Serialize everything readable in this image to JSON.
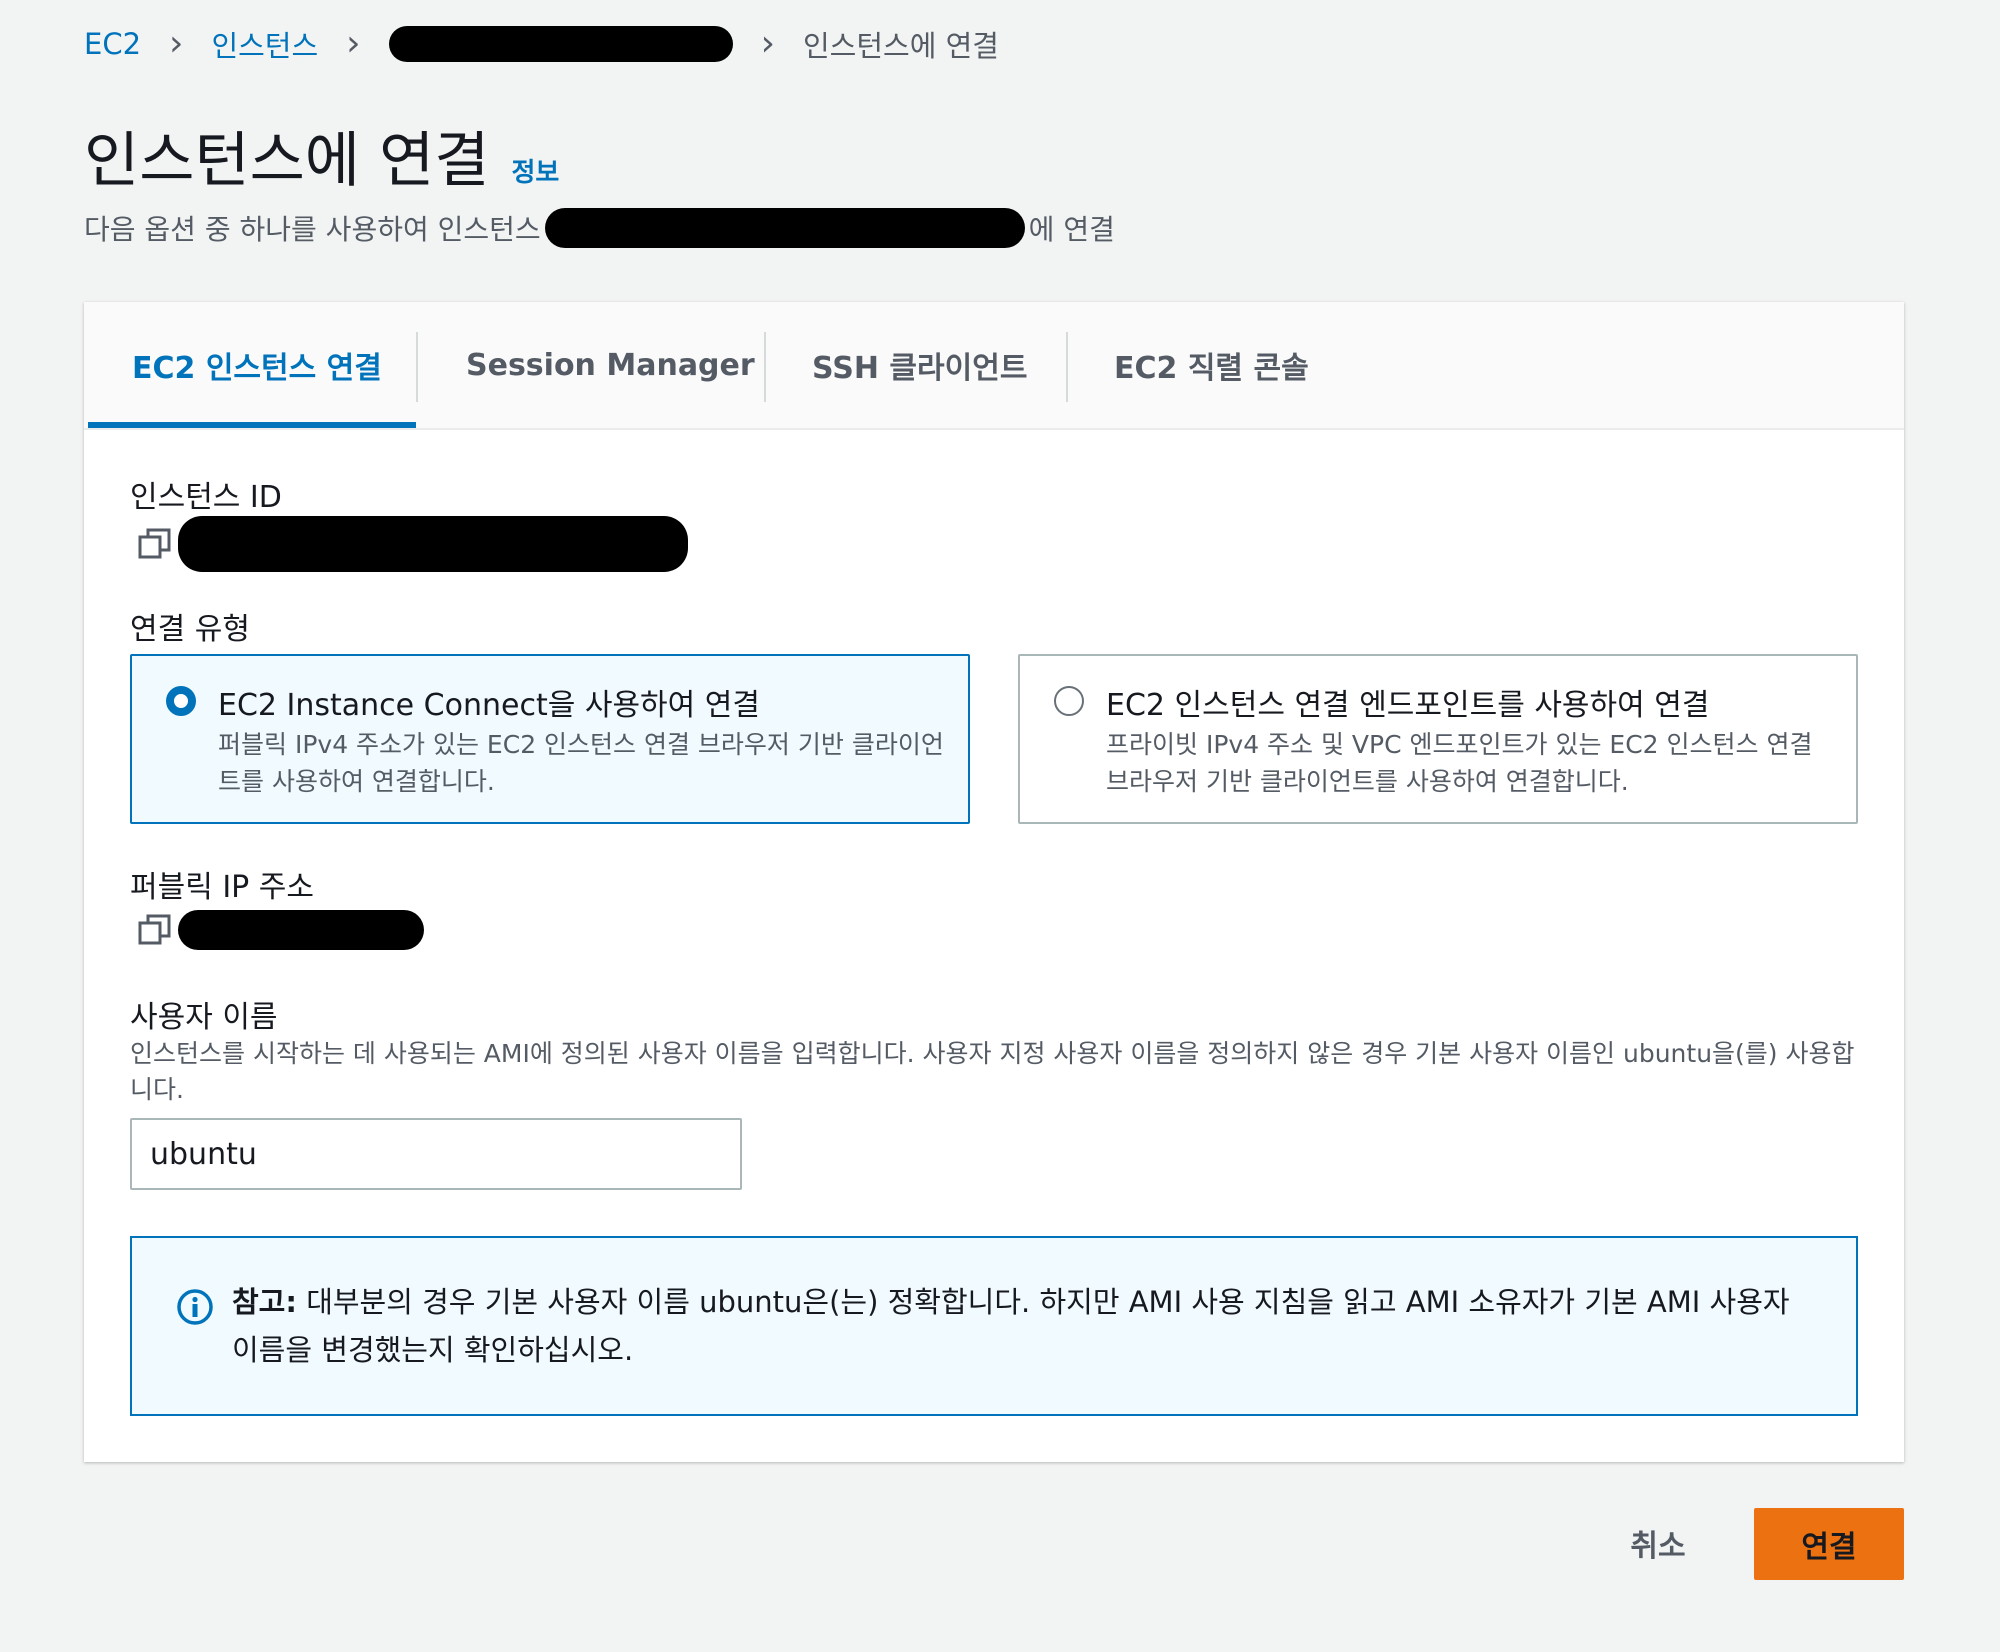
{
  "breadcrumb": {
    "items": [
      "EC2",
      "인스턴스"
    ],
    "current": "인스턴스에 연결"
  },
  "header": {
    "title": "인스턴스에 연결",
    "info_link": "정보",
    "subtitle_prefix": "다음 옵션 중 하나를 사용하여 인스턴스",
    "subtitle_suffix": "에 연결"
  },
  "tabs": [
    {
      "label": "EC2 인스턴스 연결",
      "active": true
    },
    {
      "label": "Session Manager",
      "active": false
    },
    {
      "label": "SSH 클라이언트",
      "active": false
    },
    {
      "label": "EC2 직렬 콘솔",
      "active": false
    }
  ],
  "instance_id": {
    "label": "인스턴스 ID"
  },
  "connection_type": {
    "label": "연결 유형",
    "options": [
      {
        "title": "EC2 Instance Connect을 사용하여 연결",
        "description": "퍼블릭 IPv4 주소가 있는 EC2 인스턴스 연결 브라우저 기반 클라이언트를 사용하여 연결합니다.",
        "selected": true
      },
      {
        "title": "EC2 인스턴스 연결 엔드포인트를 사용하여 연결",
        "description": "프라이빗 IPv4 주소 및 VPC 엔드포인트가 있는 EC2 인스턴스 연결 브라우저 기반 클라이언트를 사용하여 연결합니다.",
        "selected": false
      }
    ]
  },
  "public_ip": {
    "label": "퍼블릭 IP 주소"
  },
  "username": {
    "label": "사용자 이름",
    "hint": "인스턴스를 시작하는 데 사용되는 AMI에 정의된 사용자 이름을 입력합니다. 사용자 지정 사용자 이름을 정의하지 않은 경우 기본 사용자 이름인 ubuntu을(를) 사용합니다.",
    "value": "ubuntu"
  },
  "alert": {
    "prefix": "참고:",
    "text": "대부분의 경우 기본 사용자 이름 ubuntu은(는) 정확합니다. 하지만 AMI 사용 지침을 읽고 AMI 소유자가 기본 AMI 사용자 이름을 변경했는지 확인하십시오."
  },
  "actions": {
    "cancel": "취소",
    "connect": "연결"
  },
  "colors": {
    "accent": "#0073bb",
    "primary_button": "#ec7211",
    "background": "#f2f3f3"
  }
}
